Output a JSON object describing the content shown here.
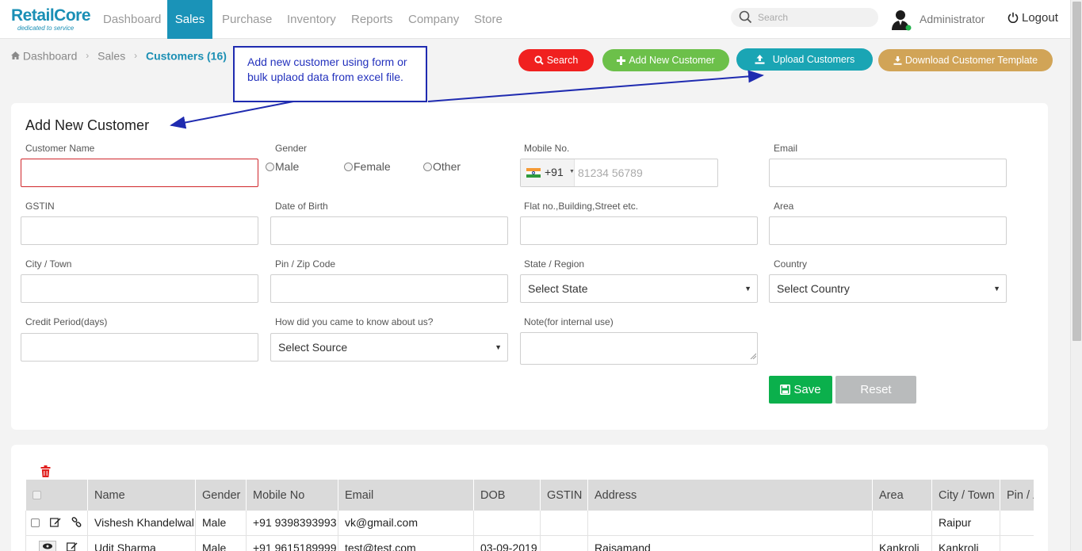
{
  "app": {
    "brand": "RetailCore",
    "tagline": "dedicated to service"
  },
  "nav": {
    "items": [
      "Dashboard",
      "Sales",
      "Purchase",
      "Inventory",
      "Reports",
      "Company",
      "Store"
    ],
    "active": "Sales",
    "search_placeholder": "Search",
    "user_name": "Administrator",
    "logout_label": "Logout"
  },
  "breadcrumb": {
    "home": "Dashboard",
    "section": "Sales",
    "current": "Customers (16)"
  },
  "actions": {
    "search_label": "Search",
    "add_label": "Add New Customer",
    "upload_label": "Upload Customers",
    "download_label": "Download Customer Template"
  },
  "annotation": {
    "line1": "Add new customer using form or",
    "line2": "bulk uplaod data from excel file."
  },
  "form": {
    "title": "Add New Customer",
    "labels": {
      "customer_name": "Customer Name",
      "gender": "Gender",
      "mobile": "Mobile No.",
      "email": "Email",
      "gstin": "GSTIN",
      "dob": "Date of Birth",
      "flat": "Flat no.,Building,Street etc.",
      "area": "Area",
      "city": "City / Town",
      "pin": "Pin / Zip Code",
      "state": "State / Region",
      "country": "Country",
      "credit": "Credit Period(days)",
      "source": "How did you came to know about us?",
      "note": "Note(for internal use)"
    },
    "gender_options": [
      "Male",
      "Female",
      "Other"
    ],
    "phone_code": "+91",
    "phone_placeholder": "81234 56789",
    "state_value": "Select State",
    "country_value": "Select Country",
    "source_value": "Select Source",
    "save_label": "Save",
    "reset_label": "Reset"
  },
  "table": {
    "columns": [
      "Name",
      "Gender",
      "Mobile No",
      "Email",
      "DOB",
      "GSTIN",
      "Address",
      "Area",
      "City / Town",
      "Pin / Z"
    ],
    "rows": [
      {
        "name": "Vishesh Khandelwal",
        "gender": "Male",
        "mobile": "+91 9398393993",
        "email": "vk@gmail.com",
        "dob": "",
        "gstin": "",
        "address": "",
        "area": "",
        "city": "Raipur",
        "pin": ""
      },
      {
        "name": "Udit Sharma",
        "gender": "Male",
        "mobile": "+91 9615189999",
        "email": "test@test.com",
        "dob": "03-09-2019",
        "gstin": "",
        "address": "Rajsamand",
        "area": "Kankroli",
        "city": "Kankroli",
        "pin": ""
      }
    ]
  },
  "colors": {
    "brand": "#1a93b8",
    "search_btn": "#f0201f",
    "add_btn": "#6cc04a",
    "upload_btn": "#1aa5b4",
    "download_btn": "#d1a457",
    "save_btn": "#0bb04c",
    "annotation": "#1f2bb0"
  }
}
